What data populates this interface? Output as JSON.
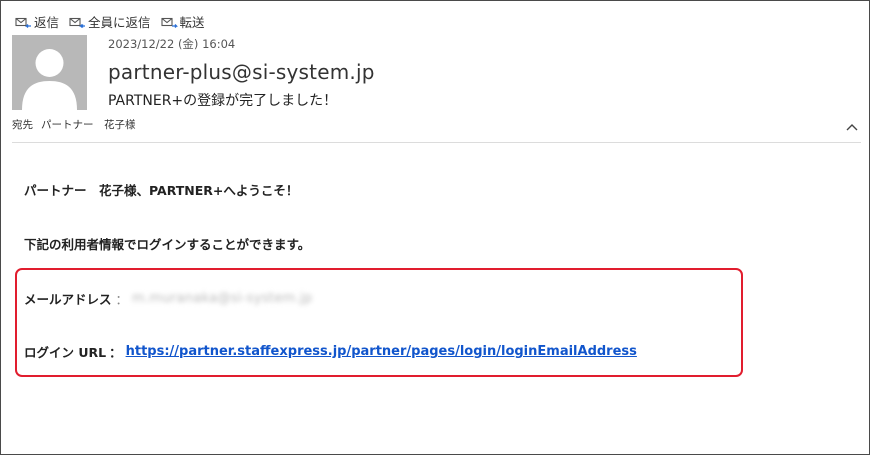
{
  "toolbar": {
    "reply_label": "返信",
    "reply_all_label": "全員に返信",
    "forward_label": "転送"
  },
  "header": {
    "date": "2023/12/22 (金) 16:04",
    "sender": "partner-plus@si-system.jp",
    "subject": "PARTNER+の登録が完了しました！",
    "to_label": "宛先",
    "to_name": "パートナー　花子様"
  },
  "message": {
    "greeting": "パートナー　花子様、PARTNER+へようこそ！",
    "intro": "下記の利用者情報でログインすることができます。",
    "email_label": "メールアドレス",
    "email_separator": "：",
    "email_value": "m.muranaka@si-system.jp",
    "login_label": "ログイン URL",
    "login_separator": "：",
    "login_url": "https://partner.staffexpress.jp/partner/pages/login/loginEmailAddress"
  },
  "colors": {
    "highlight_border": "#e11d2e",
    "link": "#1155cc"
  },
  "icons": [
    "reply-icon",
    "reply-all-icon",
    "forward-icon",
    "avatar-person-icon",
    "chevron-up-icon"
  ]
}
